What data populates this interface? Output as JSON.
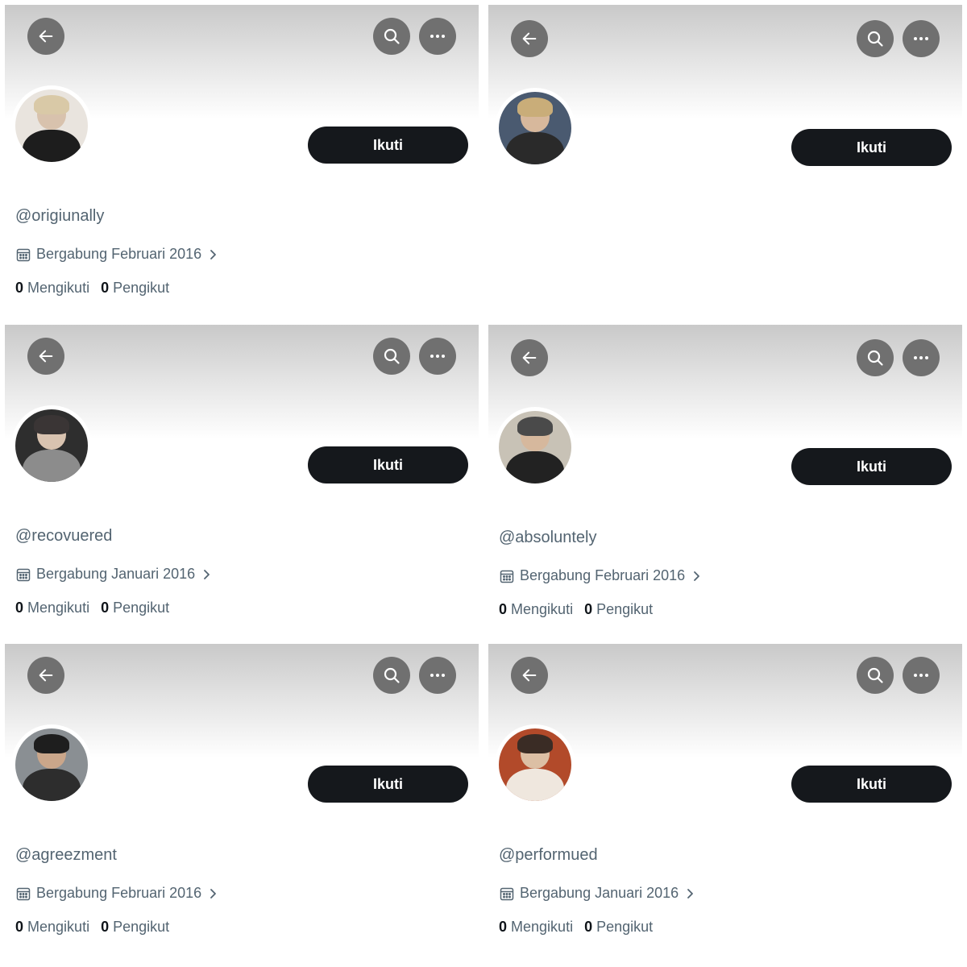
{
  "labels": {
    "follow": "Ikuti",
    "following": "Mengikuti",
    "followers": "Pengikut"
  },
  "icons": {
    "back": "arrow-left-icon",
    "search": "search-icon",
    "more": "more-horizontal-icon",
    "calendar": "calendar-icon",
    "chevron": "chevron-right-icon"
  },
  "colors": {
    "button_dark": "#15181c",
    "icon_circle": "#707070",
    "muted_text": "#536471"
  },
  "profiles": [
    {
      "handle": "@origiunally",
      "joined": "Bergabung Februari 2016",
      "following_count": "0",
      "follower_count": "0",
      "details_visible": true
    },
    {
      "handle": "",
      "joined": "",
      "following_count": "",
      "follower_count": "",
      "details_visible": false
    },
    {
      "handle": "@recovuered",
      "joined": "Bergabung Januari 2016",
      "following_count": "0",
      "follower_count": "0",
      "details_visible": true
    },
    {
      "handle": "@absoluntely",
      "joined": "Bergabung Februari 2016",
      "following_count": "0",
      "follower_count": "0",
      "details_visible": true
    },
    {
      "handle": "@agreezment",
      "joined": "Bergabung Februari 2016",
      "following_count": "0",
      "follower_count": "0",
      "details_visible": true
    },
    {
      "handle": "@performued",
      "joined": "Bergabung Januari 2016",
      "following_count": "0",
      "follower_count": "0",
      "details_visible": true
    }
  ]
}
